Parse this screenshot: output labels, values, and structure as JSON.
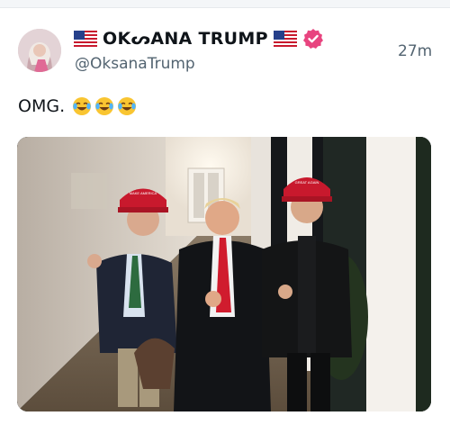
{
  "post": {
    "display_name": "OKᔕANA TRUMP",
    "handle": "@OksanaTrump",
    "timestamp": "27m",
    "text": "OMG.",
    "emojis": [
      "face-with-tears-of-joy",
      "face-with-tears-of-joy",
      "face-with-tears-of-joy"
    ],
    "verified": true
  },
  "media": {
    "hat_text": [
      "MAKE AMERICA",
      "GREAT AGAIN"
    ]
  },
  "colors": {
    "brand_pink": "#e8447f",
    "text_primary": "#0f1419",
    "text_secondary": "#536471",
    "hat_red": "#c8192d"
  },
  "icons": [
    "us-flag-icon",
    "verified-badge-icon",
    "avatar-photo"
  ]
}
